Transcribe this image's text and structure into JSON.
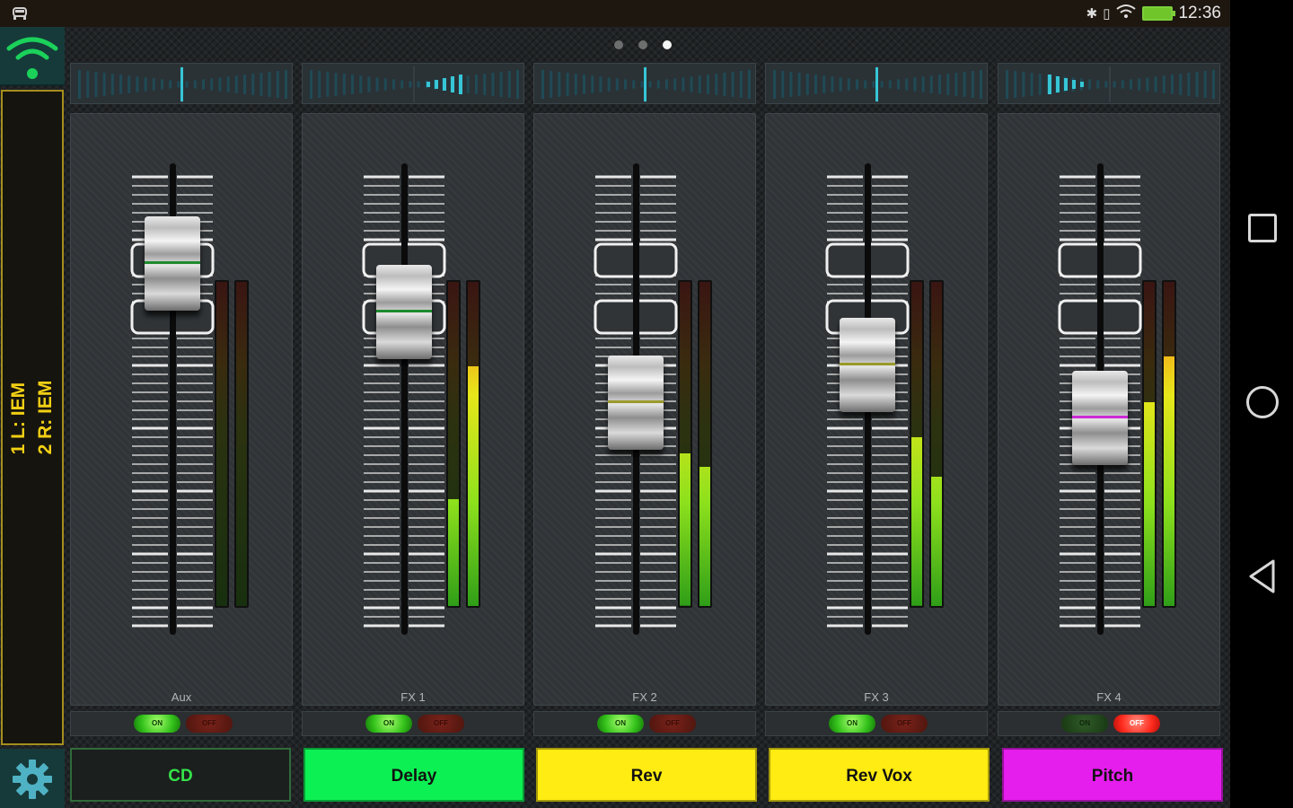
{
  "status_bar": {
    "time": "12:36",
    "notification_icon": "car-icon",
    "icons": [
      "bluetooth-icon",
      "vibrate-icon",
      "wifi-icon",
      "battery-icon"
    ]
  },
  "left_rail": {
    "wifi_icon": "wifi-icon",
    "mix_line_1": "1 L: IEM",
    "mix_line_2": "2 R: IEM",
    "accent_color": "#f2d014",
    "settings_icon": "gear-icon"
  },
  "pager": {
    "pages": 3,
    "active_page": 3
  },
  "channels": [
    {
      "label": "Aux",
      "name": "CD",
      "name_color": "#1b1f1d",
      "name_text_color": "#35e24a",
      "fader_level": 0.86,
      "cap_line_color": "#1e8a2e",
      "meter_left": 0.0,
      "meter_right": 0.0,
      "on": "ON",
      "off": "OFF",
      "state": "on",
      "pan": 0.0
    },
    {
      "label": "FX 1",
      "name": "Delay",
      "name_color": "#0df053",
      "name_text_color": "#111111",
      "fader_level": 0.73,
      "cap_line_color": "#1e8a2e",
      "meter_left": 0.33,
      "meter_right": 0.74,
      "on": "ON",
      "off": "OFF",
      "state": "on",
      "pan": 0.45
    },
    {
      "label": "FX 2",
      "name": "Rev",
      "name_color": "#ffec12",
      "name_text_color": "#111111",
      "fader_level": 0.49,
      "cap_line_color": "#9a9a2a",
      "meter_left": 0.47,
      "meter_right": 0.43,
      "on": "ON",
      "off": "OFF",
      "state": "on",
      "pan": 0.0
    },
    {
      "label": "FX 3",
      "name": "Rev Vox",
      "name_color": "#ffec12",
      "name_text_color": "#111111",
      "fader_level": 0.59,
      "cap_line_color": "#9a9a2a",
      "meter_left": 0.52,
      "meter_right": 0.4,
      "on": "ON",
      "off": "OFF",
      "state": "on",
      "pan": 0.0
    },
    {
      "label": "FX 4",
      "name": "Pitch",
      "name_color": "#e51ded",
      "name_text_color": "#111111",
      "fader_level": 0.45,
      "cap_line_color": "#cc2ad6",
      "meter_left": 0.63,
      "meter_right": 0.77,
      "on": "ON",
      "off": "OFF",
      "state": "off",
      "pan": -0.45
    }
  ],
  "nav_bar": {
    "icons": [
      "recents-icon",
      "home-icon",
      "back-icon"
    ]
  }
}
